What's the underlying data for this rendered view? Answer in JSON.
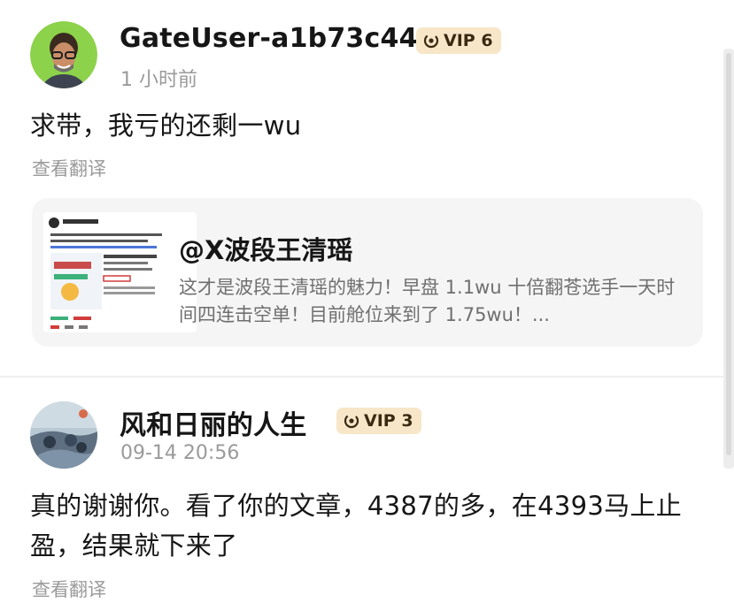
{
  "comments": [
    {
      "username": "GateUser-a1b73c44",
      "vip": "VIP 6",
      "timestamp": "1 小时前",
      "text": "求带，我亏的还剩一wu",
      "translate": "查看翻译",
      "quote": {
        "author": "@X波段王清瑶",
        "excerpt": "这才是波段王清瑶的魅力！早盘 1.1wu 十倍翻苍选手一天时间四连击空单！目前舱位来到了 1.75wu！..."
      }
    },
    {
      "username": "风和日丽的人生",
      "vip": "VIP 3",
      "timestamp": "09-14 20:56",
      "text": "真的谢谢你。看了你的文章，4387的多，在4393马上止盈，结果就下来了",
      "translate": "查看翻译"
    }
  ],
  "colors": {
    "vip_bg": "#f7e6c8",
    "muted_text": "#9a9a9a",
    "card_bg": "#f5f5f5"
  },
  "icons": {
    "vip": "vip-badge-icon"
  }
}
